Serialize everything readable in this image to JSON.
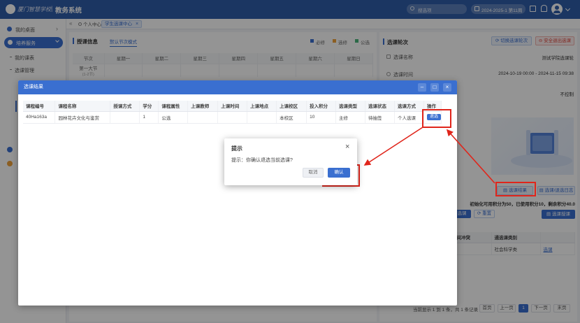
{
  "topbar": {
    "brand": "厦门智慧学校",
    "sep": "|",
    "system": "教务系统",
    "search_placeholder": "搜选项",
    "term": "2024-2025-1 第11周",
    "icons": [
      "calendar-icon",
      "fullscreen-icon",
      "bell-icon",
      "avatar",
      "chevron-down-icon"
    ]
  },
  "sidebar": {
    "items": [
      {
        "label": "我的桌面"
      },
      {
        "label": "培养服务",
        "active": true
      },
      {
        "label": "我的课表"
      },
      {
        "label": "选课管理"
      }
    ]
  },
  "tabs": [
    {
      "label": "个人中心"
    },
    {
      "label": "学生选课中心",
      "active": true,
      "close": "×"
    }
  ],
  "schedule": {
    "title": "授课信息",
    "mode": "默认节次模式",
    "legend": [
      {
        "label": "必修",
        "color": "#3a6fd0"
      },
      {
        "label": "选修",
        "color": "#f0a23c"
      },
      {
        "label": "公选",
        "color": "#4cb67a"
      }
    ],
    "headers": [
      "节次",
      "星期一",
      "星期二",
      "星期三",
      "星期四",
      "星期五",
      "星期六",
      "星期日"
    ],
    "first_period": "第一大节",
    "first_period_sub": "(1-2节)"
  },
  "round": {
    "title": "选课轮次",
    "switch_btn": "切换选课轮次",
    "exit_btn": "安全退出选课",
    "rows": [
      {
        "label": "选课名称",
        "value": "测试学院选课轮"
      },
      {
        "label": "选课时间",
        "value": "2024-10-19 00:00 - 2024-11-15 09:38"
      },
      {
        "label": "",
        "value": "不控制"
      }
    ],
    "result_btn": "选课结果",
    "log_btn": "选课/退选日志",
    "credits_text": "初始化可用积分为50，已使用积分10，剩余积分40.0",
    "filter_btn": "选课",
    "reset_btn": "重置",
    "teach_btn": "选课授课",
    "lower_headers": [
      "时间冲突",
      "通选课类别",
      ""
    ],
    "lower_row": [
      "",
      "社会科学类",
      "选课"
    ]
  },
  "pagination": {
    "info": "当前显示 1 到 1 条，共 1 条记录",
    "first": "首页",
    "prev": "上一页",
    "page": "1",
    "next": "下一页",
    "last": "末页"
  },
  "result_modal": {
    "title": "选课结果",
    "controls": [
      "minimize-icon",
      "maximize-icon",
      "close-icon"
    ],
    "headers": [
      "课程编号",
      "课程名称",
      "授课方式",
      "学分",
      "课程属性",
      "上课教师",
      "上课时间",
      "上课地点",
      "上课校区",
      "投入积分",
      "选课类型",
      "选课状态",
      "选课方式",
      "操作"
    ],
    "rows": [
      [
        "40Ha163a",
        "园林花卉文化与鉴赏",
        "",
        "1",
        "公选",
        "",
        "",
        "",
        "本校区",
        "10",
        "主修",
        "待抽签",
        "个人选课",
        "退选"
      ]
    ]
  },
  "confirm": {
    "title": "提示",
    "close": "×",
    "message": "提示：你确认退选当前选课?",
    "cancel": "取消",
    "ok": "确认"
  }
}
